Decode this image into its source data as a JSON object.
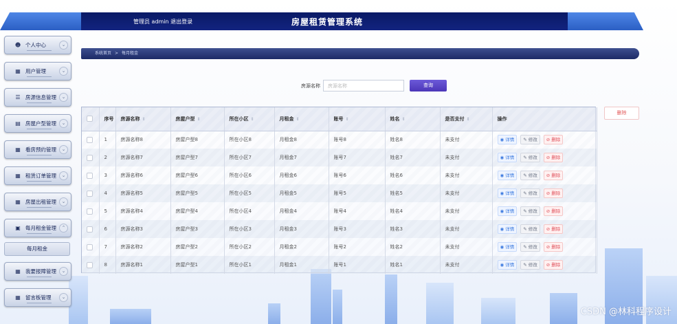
{
  "header": {
    "user_text": "管理员 admin  退出登录",
    "title": "房屋租赁管理系统"
  },
  "sidebar": {
    "items": [
      {
        "label": "个人中心",
        "icon": "person-icon"
      },
      {
        "label": "用户管理",
        "icon": "grid-icon"
      },
      {
        "label": "房源信息管理",
        "icon": "sliders-icon"
      },
      {
        "label": "房屋户型管理",
        "icon": "bar-chart-icon"
      },
      {
        "label": "看房预约管理",
        "icon": "grid-icon"
      },
      {
        "label": "租赁订单管理",
        "icon": "grid-icon"
      },
      {
        "label": "房屋出租管理",
        "icon": "grid-icon"
      },
      {
        "label": "每月租金管理",
        "icon": "building-icon"
      },
      {
        "label": "我要报障管理",
        "icon": "grid-icon"
      },
      {
        "label": "留言板管理",
        "icon": "grid-icon"
      }
    ],
    "sub_item": "每月租金"
  },
  "breadcrumb": {
    "home": "系统首页",
    "current": "每月租金"
  },
  "search": {
    "label": "房源名称",
    "placeholder": "房源名称",
    "button": "查询"
  },
  "delete_batch": "删除",
  "table": {
    "headers": [
      "序号",
      "房源名称",
      "房屋户型",
      "所在小区",
      "月租金",
      "账号",
      "姓名",
      "是否支付",
      "操作"
    ],
    "rows": [
      {
        "idx": "1",
        "name": "房源名称8",
        "type": "房屋户型8",
        "community": "所在小区8",
        "rent": "月租金8",
        "account": "账号8",
        "person": "姓名8",
        "paid": "未支付"
      },
      {
        "idx": "2",
        "name": "房源名称7",
        "type": "房屋户型7",
        "community": "所在小区7",
        "rent": "月租金7",
        "account": "账号7",
        "person": "姓名7",
        "paid": "未支付"
      },
      {
        "idx": "3",
        "name": "房源名称6",
        "type": "房屋户型6",
        "community": "所在小区6",
        "rent": "月租金6",
        "account": "账号6",
        "person": "姓名6",
        "paid": "未支付"
      },
      {
        "idx": "4",
        "name": "房源名称5",
        "type": "房屋户型5",
        "community": "所在小区5",
        "rent": "月租金5",
        "account": "账号5",
        "person": "姓名5",
        "paid": "未支付"
      },
      {
        "idx": "5",
        "name": "房源名称4",
        "type": "房屋户型4",
        "community": "所在小区4",
        "rent": "月租金4",
        "account": "账号4",
        "person": "姓名4",
        "paid": "未支付"
      },
      {
        "idx": "6",
        "name": "房源名称3",
        "type": "房屋户型3",
        "community": "所在小区3",
        "rent": "月租金3",
        "account": "账号3",
        "person": "姓名3",
        "paid": "未支付"
      },
      {
        "idx": "7",
        "name": "房源名称2",
        "type": "房屋户型2",
        "community": "所在小区2",
        "rent": "月租金2",
        "account": "账号2",
        "person": "姓名2",
        "paid": "未支付"
      },
      {
        "idx": "8",
        "name": "房源名称1",
        "type": "房屋户型1",
        "community": "所在小区1",
        "rent": "月租金1",
        "account": "账号1",
        "person": "姓名1",
        "paid": "未支付"
      }
    ],
    "ops": {
      "detail": "详情",
      "edit": "修改",
      "delete": "删除"
    }
  },
  "watermark": "CSDN @林科程序设计"
}
